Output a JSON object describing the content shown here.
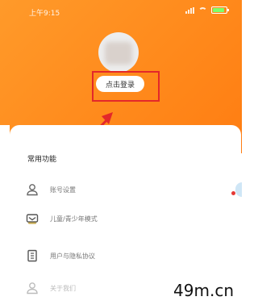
{
  "status_bar": {
    "time": "上午9:15"
  },
  "profile": {
    "login_button": "点击登录"
  },
  "menu": {
    "title": "常用功能",
    "items": [
      {
        "label": "账号设置",
        "icon": "user-icon"
      },
      {
        "label": "儿童/青少年模式",
        "icon": "child-mode-icon"
      },
      {
        "label": "用户与隐私协议",
        "icon": "document-icon"
      },
      {
        "label": "关于我们",
        "icon": "about-icon"
      }
    ]
  },
  "watermark": "49m.cn",
  "colors": {
    "header": "#ff8a1c",
    "highlight": "#e3282a"
  }
}
